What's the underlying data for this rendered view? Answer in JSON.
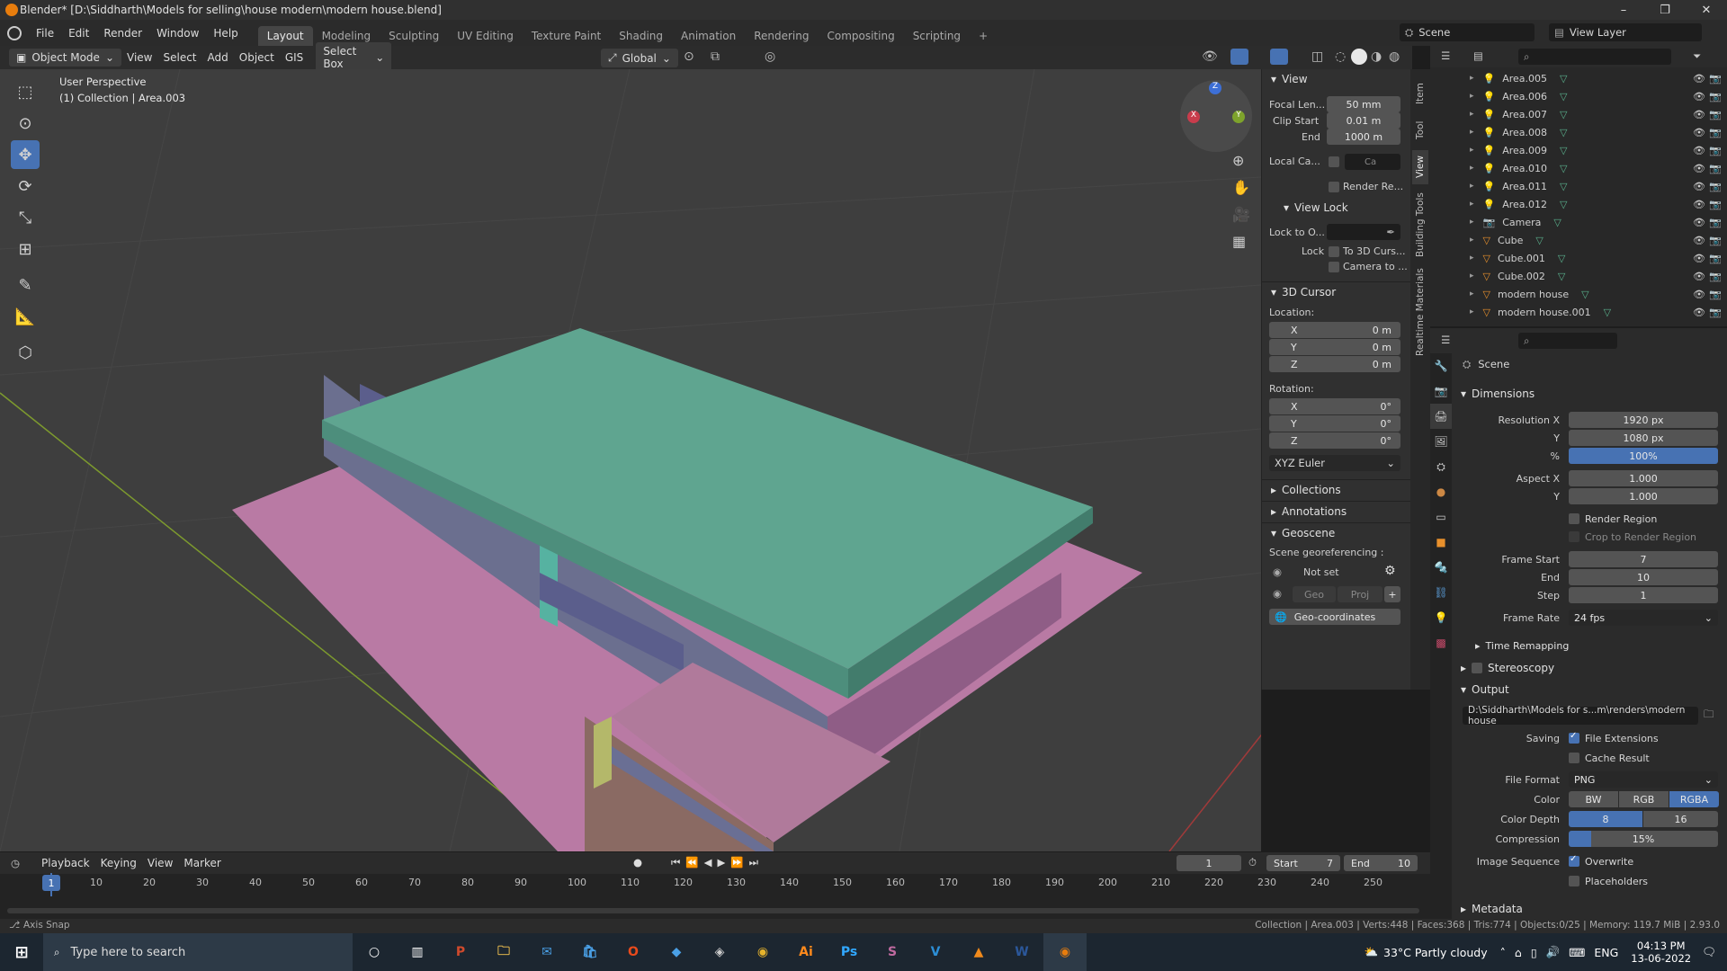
{
  "window": {
    "title": "Blender* [D:\\Siddharth\\Models for selling\\house modern\\modern house.blend]",
    "minimize": "–",
    "maximize": "❐",
    "close": "✕"
  },
  "menus": [
    "File",
    "Edit",
    "Render",
    "Window",
    "Help"
  ],
  "workspaces": [
    "Layout",
    "Modeling",
    "Sculpting",
    "UV Editing",
    "Texture Paint",
    "Shading",
    "Animation",
    "Rendering",
    "Compositing",
    "Scripting"
  ],
  "workspace_add": "+",
  "scene_selector": {
    "value": "Scene"
  },
  "view_layer_selector": {
    "value": "View Layer"
  },
  "header3d": {
    "mode": "Object Mode",
    "menus": [
      "View",
      "Select",
      "Add",
      "Object",
      "GIS"
    ],
    "select_box": "Select Box",
    "orientation": "Global"
  },
  "viewport": {
    "perspective": "User Perspective",
    "collection": "(1) Collection | Area.003",
    "gizmo": {
      "x": "X",
      "y": "Y",
      "z": "Z"
    }
  },
  "npanel": {
    "view_header": "View",
    "focal_length_label": "Focal Len...",
    "focal_length": "50 mm",
    "clip_start_label": "Clip Start",
    "clip_start": "0.01 m",
    "end_label": "End",
    "end": "1000 m",
    "local_camera_label": "Local Ca...",
    "local_camera_value": "Ca",
    "render_region_label": "Render Re...",
    "view_lock_header": "View Lock",
    "lock_to_object_label": "Lock to O...",
    "lock_label": "Lock",
    "to_3d_cursor": "To 3D Curs...",
    "camera_to": "Camera to ...",
    "cursor_header": "3D Cursor",
    "location_label": "Location:",
    "loc": [
      {
        "axis": "X",
        "value": "0 m"
      },
      {
        "axis": "Y",
        "value": "0 m"
      },
      {
        "axis": "Z",
        "value": "0 m"
      }
    ],
    "rotation_label": "Rotation:",
    "rot": [
      {
        "axis": "X",
        "value": "0°"
      },
      {
        "axis": "Y",
        "value": "0°"
      },
      {
        "axis": "Z",
        "value": "0°"
      }
    ],
    "rotation_mode": "XYZ Euler",
    "collections_header": "Collections",
    "annotations_header": "Annotations",
    "geoscene_header": "Geoscene",
    "scene_georef_label": "Scene georeferencing :",
    "not_set": "Not set",
    "geo_btn": "Geo",
    "proj_btn": "Proj",
    "geo_add": "+",
    "geo_coordinates": "Geo-coordinates"
  },
  "side_tabs": [
    "Item",
    "Tool",
    "View",
    "Building Tools",
    "Realtime Materials"
  ],
  "outliner": {
    "rows": [
      {
        "name": "Area.005",
        "type": "light"
      },
      {
        "name": "Area.006",
        "type": "light"
      },
      {
        "name": "Area.007",
        "type": "light"
      },
      {
        "name": "Area.008",
        "type": "light"
      },
      {
        "name": "Area.009",
        "type": "light"
      },
      {
        "name": "Area.010",
        "type": "light"
      },
      {
        "name": "Area.011",
        "type": "light"
      },
      {
        "name": "Area.012",
        "type": "light"
      },
      {
        "name": "Camera",
        "type": "camera"
      },
      {
        "name": "Cube",
        "type": "mesh"
      },
      {
        "name": "Cube.001",
        "type": "mesh"
      },
      {
        "name": "Cube.002",
        "type": "mesh"
      },
      {
        "name": "modern house",
        "type": "mesh"
      },
      {
        "name": "modern house.001",
        "type": "mesh"
      }
    ]
  },
  "properties": {
    "scene_label": "Scene",
    "dimensions_header": "Dimensions",
    "res_x_label": "Resolution X",
    "res_x": "1920 px",
    "res_y_label": "Y",
    "res_y": "1080 px",
    "res_pct_label": "%",
    "res_pct": "100%",
    "aspect_x_label": "Aspect X",
    "aspect_x": "1.000",
    "aspect_y_label": "Y",
    "aspect_y": "1.000",
    "render_region": "Render Region",
    "crop_region": "Crop to Render Region",
    "frame_start_label": "Frame Start",
    "frame_start": "7",
    "frame_end_label": "End",
    "frame_end": "10",
    "frame_step_label": "Step",
    "frame_step": "1",
    "frame_rate_label": "Frame Rate",
    "frame_rate": "24 fps",
    "time_remapping": "Time Remapping",
    "stereoscopy": "Stereoscopy",
    "output_header": "Output",
    "output_path": "D:\\Siddharth\\Models for s...m\\renders\\modern house",
    "saving_label": "Saving",
    "file_extensions": "File Extensions",
    "cache_result": "Cache Result",
    "file_format_label": "File Format",
    "file_format": "PNG",
    "color_label": "Color",
    "color_opts": [
      "BW",
      "RGB",
      "RGBA"
    ],
    "depth_label": "Color Depth",
    "depth_opts": [
      "8",
      "16"
    ],
    "compression_label": "Compression",
    "compression": "15%",
    "image_seq_label": "Image Sequence",
    "overwrite": "Overwrite",
    "placeholders": "Placeholders",
    "metadata_header": "Metadata"
  },
  "timeline": {
    "menus": [
      "Playback",
      "Keying",
      "View",
      "Marker"
    ],
    "current_frame": "1",
    "start_label": "Start",
    "start": "7",
    "end_label": "End",
    "end": "10",
    "ticks": [
      "10",
      "20",
      "30",
      "40",
      "50",
      "60",
      "70",
      "80",
      "90",
      "100",
      "110",
      "120",
      "130",
      "140",
      "150",
      "160",
      "170",
      "180",
      "190",
      "200",
      "210",
      "220",
      "230",
      "240",
      "250"
    ],
    "cursor_frame": "1"
  },
  "statusbar": {
    "left": "Axis Snap",
    "right": "Collection | Area.003 | Verts:448 | Faces:368 | Tris:774 | Objects:0/25 | Memory: 119.7 MiB | 2.93.0"
  },
  "taskbar": {
    "search_placeholder": "Type here to search",
    "weather": "33°C  Partly cloudy",
    "lang": "ENG",
    "time": "04:13 PM",
    "date": "13-06-2022"
  }
}
